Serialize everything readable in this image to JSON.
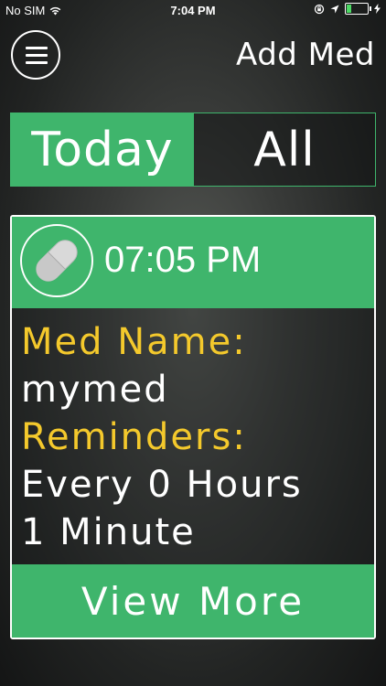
{
  "status_bar": {
    "carrier": "No SIM",
    "time": "7:04 PM",
    "battery_level": 0.25
  },
  "header": {
    "menu_icon": "hamburger-icon",
    "add_med_label": "Add Med"
  },
  "filter": {
    "today_label": "Today",
    "all_label": "All",
    "selected": "Today"
  },
  "med_card": {
    "time": "07:05 PM",
    "icon": "pill-icon",
    "med_name_label": "Med Name:",
    "med_name": "mymed",
    "reminders_label": "Reminders:",
    "reminders_line1": "Every 0 Hours",
    "reminders_line2": "1 Minute",
    "view_more_label": "View More"
  },
  "colors": {
    "accent_green": "#3fb56c",
    "label_yellow": "#f4c92c"
  }
}
